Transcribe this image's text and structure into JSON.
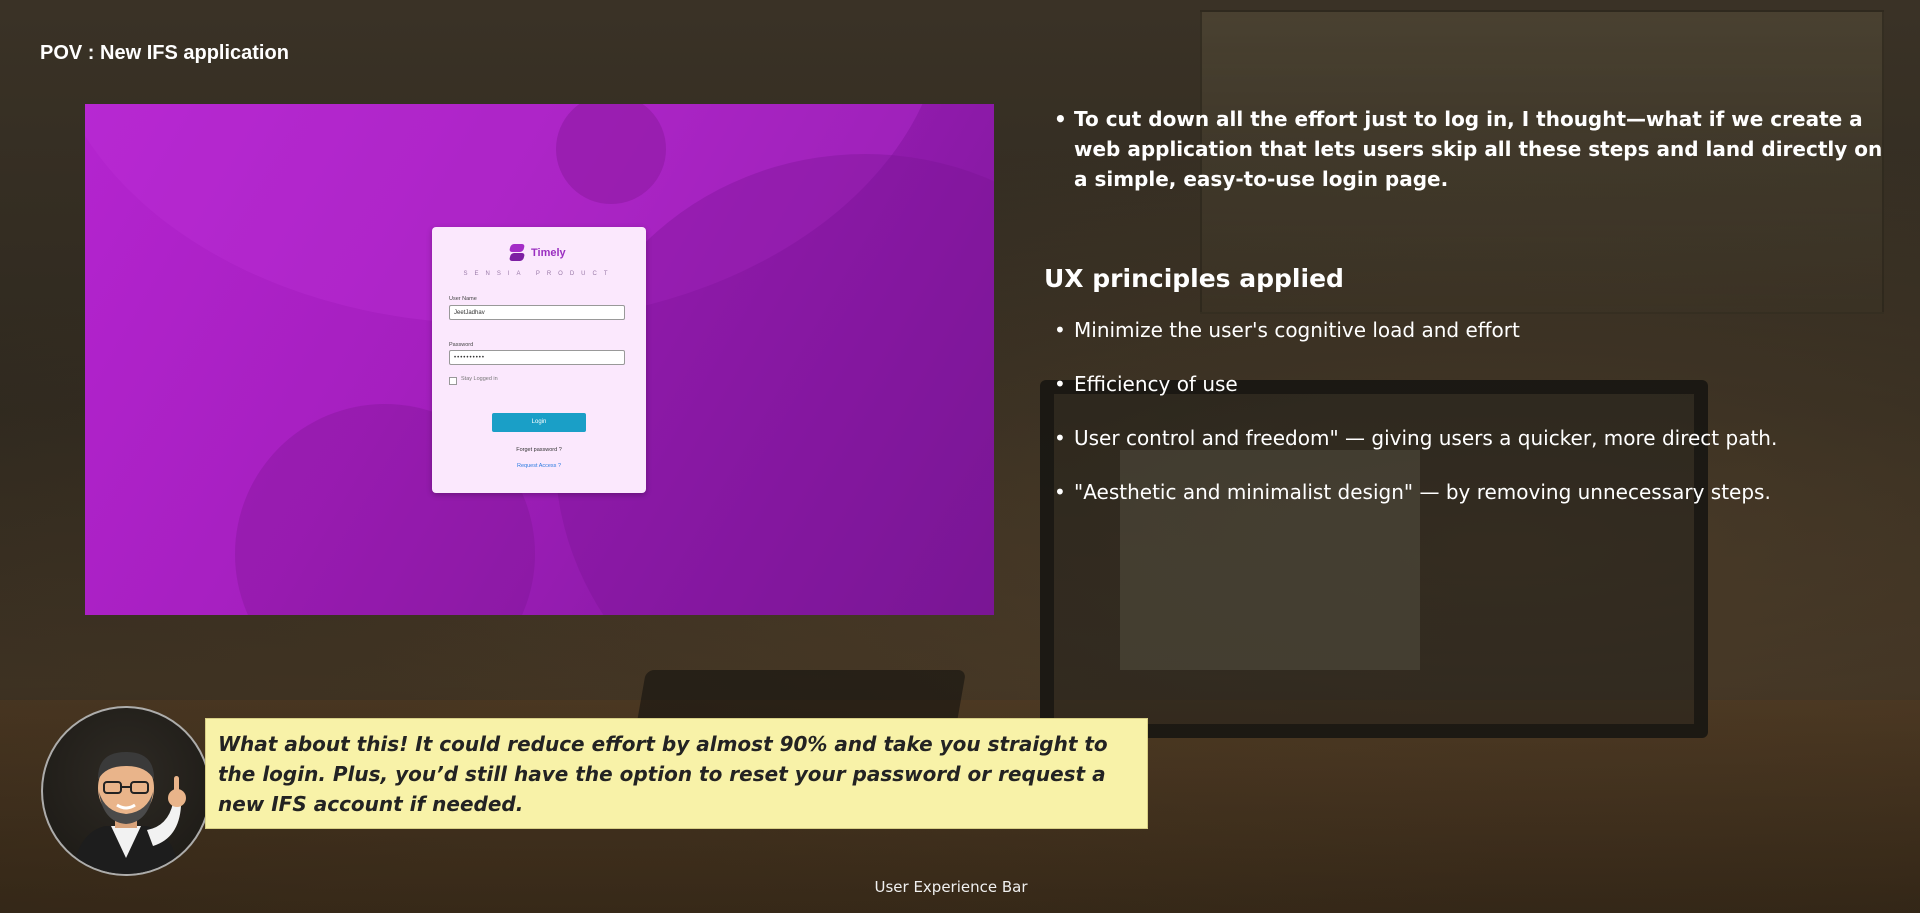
{
  "header": {
    "title": "POV : New IFS application"
  },
  "mockup": {
    "brand": "Timely",
    "tagline": "SENSIA PRODUCT",
    "username_label": "User Name",
    "username_value": "JeetJadhav",
    "password_label": "Password",
    "password_value": "••••••••••",
    "stay_logged_in": "Stay Logged in",
    "login_button": "Login",
    "forgot_password": "Forget password ?",
    "request_access": "Request Access ?",
    "colors": {
      "background": "#a51fbf",
      "card": "#fbe8fd",
      "button": "#1a9fc7",
      "link": "#2a7be0"
    }
  },
  "content": {
    "intro": "To cut down all the effort just to log in, I thought—what if we create a web application that lets users skip all these steps and land directly on a simple, easy-to-use login page.",
    "ux_heading": "UX principles applied",
    "principles": [
      "Minimize the user's cognitive load and effort",
      "Efficiency of use",
      "User control and freedom\" — giving users a quicker, more direct path.",
      "\"Aesthetic and minimalist design\" — by removing unnecessary steps."
    ]
  },
  "speech": {
    "text": "What about this! It could reduce effort by almost 90% and take you straight to the login. Plus, you’d still have the option to reset your password or request a new IFS account if needed.",
    "background": "#f8f2a8"
  },
  "avatar": {
    "icon": "avatar-icon"
  },
  "footer": {
    "text": "User Experience Bar"
  }
}
